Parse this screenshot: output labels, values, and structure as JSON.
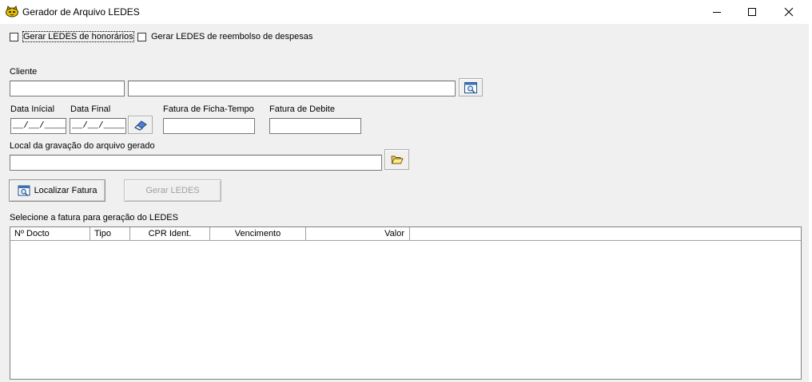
{
  "window": {
    "title": "Gerador de Arquivo LEDES",
    "minimize_glyph": "—",
    "maximize_glyph": "☐",
    "close_glyph": "✕",
    "icon": "cat-app-icon"
  },
  "options": {
    "honorarios": {
      "label": "Gerar LEDES de honorários",
      "checked": false
    },
    "reembolso": {
      "label": "Gerar LEDES de reembolso de despesas",
      "checked": false
    }
  },
  "cliente": {
    "label": "Cliente",
    "code_value": "",
    "name_value": "",
    "search_icon": "search-window-icon"
  },
  "datas": {
    "inicial_label": "Data Inícial",
    "inicial_value": "__/__/____",
    "final_label": "Data Final",
    "final_value": "__/__/____",
    "clear_icon": "eraser-icon"
  },
  "fatura_ficha": {
    "label": "Fatura de Ficha-Tempo",
    "value": ""
  },
  "fatura_debite": {
    "label": "Fatura de Debite",
    "value": ""
  },
  "local": {
    "label": "Local da gravação do arquivo gerado",
    "value": "",
    "folder_icon": "open-folder-icon"
  },
  "actions": {
    "localizar_label": "Localizar Fatura",
    "gerar_label": "Gerar LEDES",
    "gerar_enabled": false
  },
  "grid": {
    "caption": "Selecione a fatura para geração do LEDES",
    "columns": [
      "Nº Docto",
      "Tipo",
      "CPR Ident.",
      "Vencimento",
      "Valor"
    ],
    "rows": []
  },
  "colors": {
    "window_bg": "#f0f0f0",
    "titlebar_bg": "#ffffff",
    "disabled_text": "#a0a0a0"
  }
}
